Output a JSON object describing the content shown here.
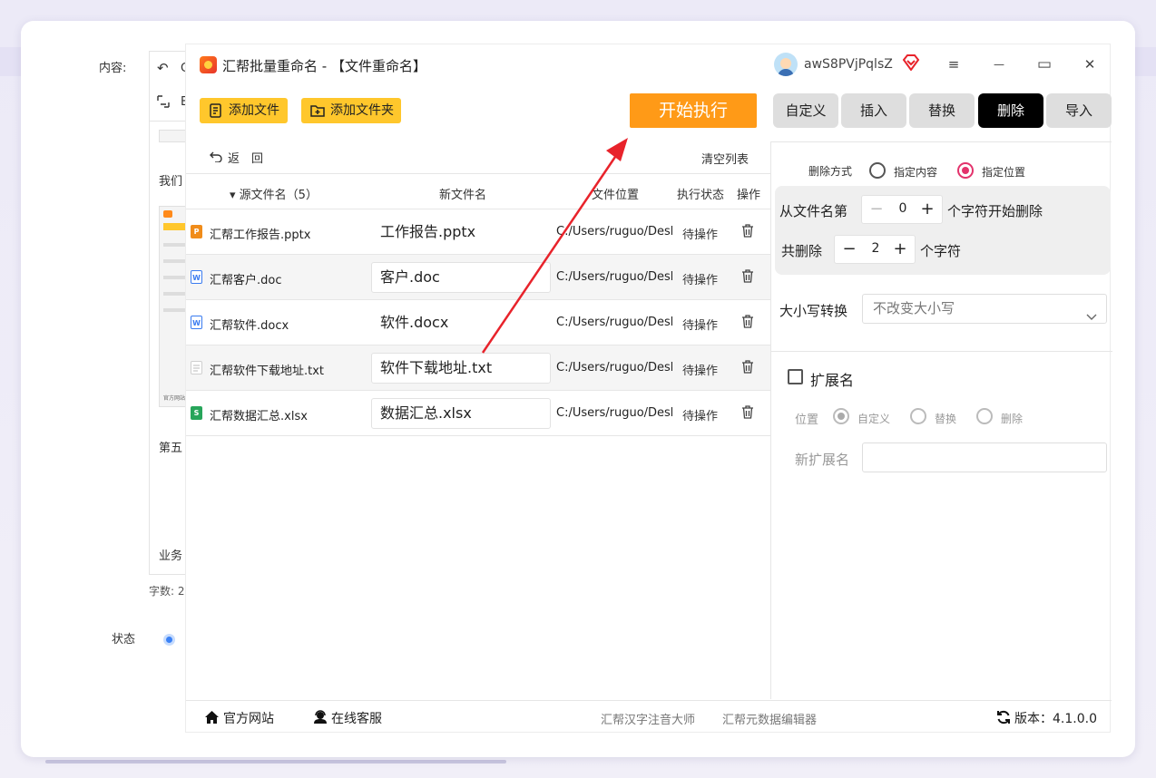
{
  "background_editor": {
    "content_label": "内容:",
    "toolbar_undo": "↶",
    "toolbar_c": "C",
    "toolbar_b": "B",
    "text_line_1": "我们",
    "text_line_2": "第五",
    "text_line_3": "业务",
    "thumb_caption": "官方网站",
    "word_count": "字数: 2",
    "status_label": "状态"
  },
  "app": {
    "title": "汇帮批量重命名 - 【文件重命名】",
    "username": "awS8PVjPqlsZ",
    "window_controls": {
      "menu": "≡",
      "minimize": "—",
      "maximize": "▭",
      "close": "✕"
    }
  },
  "toolbar": {
    "add_file": "添加文件",
    "add_folder": "添加文件夹",
    "start": "开始执行"
  },
  "tabs": [
    {
      "label": "自定义",
      "active": false
    },
    {
      "label": "插入",
      "active": false
    },
    {
      "label": "替换",
      "active": false
    },
    {
      "label": "删除",
      "active": true
    },
    {
      "label": "导入",
      "active": false
    }
  ],
  "list": {
    "back": "返　回",
    "clear": "清空列表",
    "headers": {
      "source": "源文件名（5）",
      "new": "新文件名",
      "location": "文件位置",
      "status": "执行状态",
      "action": "操作"
    },
    "rows": [
      {
        "icon": "pptx-icon",
        "icon_color": "#f08c1a",
        "icon_text": "P",
        "source": "汇帮工作报告.pptx",
        "new": "工作报告.pptx",
        "path": "C:/Users/ruguo/Desktop",
        "status": "待操作"
      },
      {
        "icon": "word-icon",
        "icon_color": "#3a7bf0",
        "icon_text": "W",
        "source": "汇帮客户.doc",
        "new": "客户.doc",
        "path": "C:/Users/ruguo/Desktop",
        "status": "待操作"
      },
      {
        "icon": "word-icon",
        "icon_color": "#3a7bf0",
        "icon_text": "W",
        "source": "汇帮软件.docx",
        "new": "软件.docx",
        "path": "C:/Users/ruguo/Desktop",
        "status": "待操作"
      },
      {
        "icon": "txt-icon",
        "icon_color": "#d9d9d9",
        "icon_text": "",
        "source": "汇帮软件下载地址.txt",
        "new": "软件下载地址.txt",
        "path": "C:/Users/ruguo/Desktop",
        "status": "待操作"
      },
      {
        "icon": "excel-icon",
        "icon_color": "#27a55a",
        "icon_text": "S",
        "source": "汇帮数据汇总.xlsx",
        "new": "数据汇总.xlsx",
        "path": "C:/Users/ruguo/Desktop",
        "status": "待操作"
      }
    ]
  },
  "delete_panel": {
    "mode_label": "删除方式",
    "mode_option_content": "指定内容",
    "mode_option_position": "指定位置",
    "mode_selected": "指定位置",
    "from_prefix": "从文件名第",
    "from_value": "0",
    "from_suffix": "个字符开始删除",
    "count_prefix": "共删除",
    "count_value": "2",
    "count_suffix": "个字符",
    "case_label": "大小写转换",
    "case_value": "不改变大小写",
    "ext_label": "扩展名",
    "ext_position_label": "位置",
    "ext_options": [
      "自定义",
      "替换",
      "删除"
    ],
    "new_ext_label": "新扩展名"
  },
  "footer": {
    "website": "官方网站",
    "service": "在线客服",
    "link_1": "汇帮汉字注音大师",
    "link_2": "汇帮元数据编辑器",
    "version": "版本：4.1.0.0"
  },
  "colors": {
    "accent_orange": "#ff9a17",
    "button_yellow": "#ffc72c",
    "radio_pink": "#e3336c",
    "arrow_red": "#e8232b"
  }
}
